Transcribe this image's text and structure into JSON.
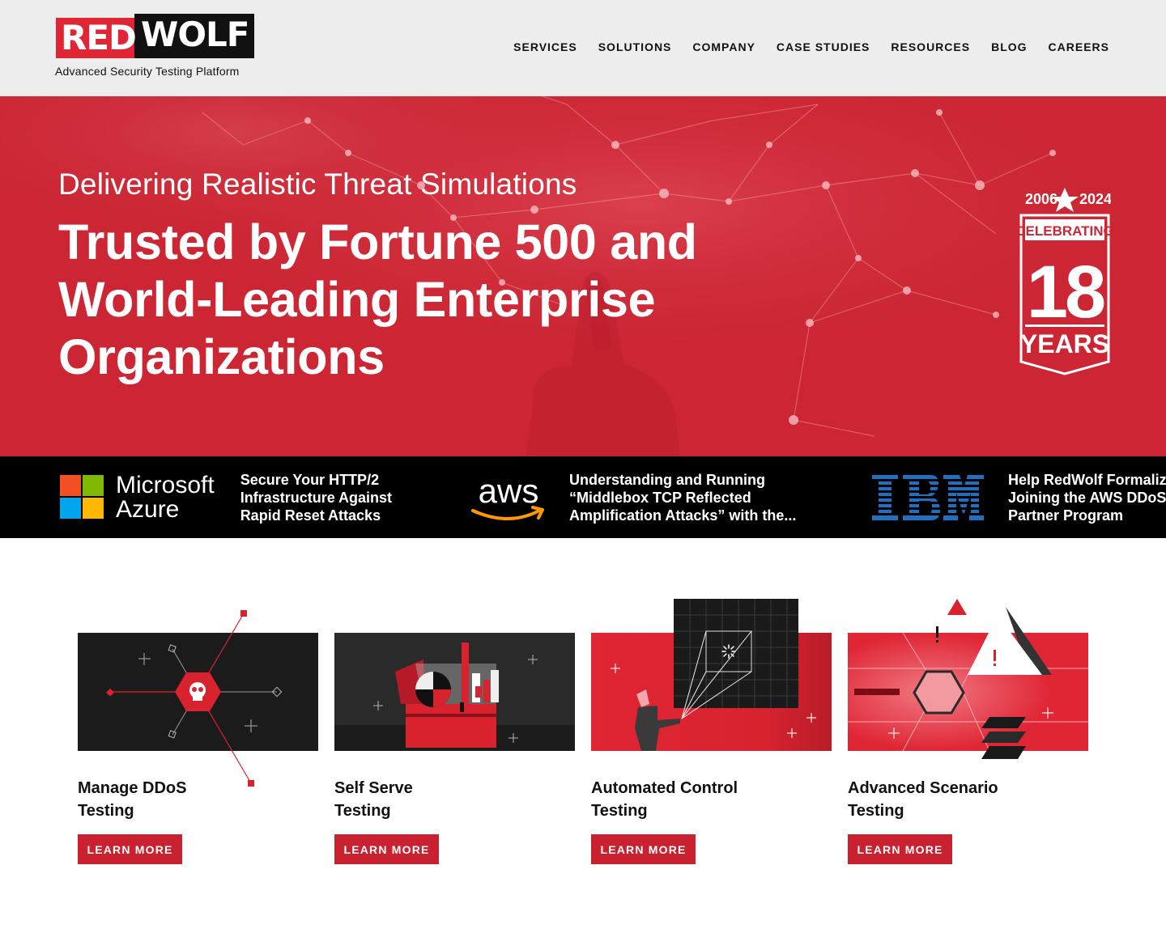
{
  "header": {
    "logo_red": "RED",
    "logo_black": "WOLF",
    "tagline": "Advanced Security Testing Platform",
    "nav": [
      "SERVICES",
      "SOLUTIONS",
      "COMPANY",
      "CASE STUDIES",
      "RESOURCES",
      "BLOG",
      "CAREERS"
    ]
  },
  "hero": {
    "subtitle": "Delivering Realistic Threat Simulations",
    "title": "Trusted by Fortune 500 and World-Leading Enterprise Organizations",
    "badge": {
      "year_start": "2006",
      "year_end": "2024",
      "celebrating": "CELEBRATING",
      "number": "18",
      "years": "YEARS"
    }
  },
  "news": [
    {
      "logo": "Microsoft Azure",
      "logo_line1": "Microsoft",
      "logo_line2": "Azure",
      "line1": "Secure Your HTTP/2",
      "line2": "Infrastructure Against",
      "line3": "Rapid Reset Attacks"
    },
    {
      "logo": "aws",
      "line1": "Understanding and Running",
      "line2": "“Middlebox TCP Reflected",
      "line3": "Amplification Attacks” with the..."
    },
    {
      "logo": "IBM",
      "line1": "Help RedWolf Formaliz",
      "line2": "Joining the AWS DDoS",
      "line3": "Partner Program"
    }
  ],
  "cards": [
    {
      "line1": "Manage DDoS",
      "line2": "Testing",
      "button": "LEARN MORE",
      "icon": "skull-hexagon-icon"
    },
    {
      "line1": "Self Serve",
      "line2": "Testing",
      "button": "LEARN MORE",
      "icon": "toolbox-icon"
    },
    {
      "line1": "Automated Control",
      "line2": "Testing",
      "button": "LEARN MORE",
      "icon": "projector-screen-icon"
    },
    {
      "line1": "Advanced Scenario",
      "line2": "Testing",
      "button": "LEARN MORE",
      "icon": "warning-triangle-icon"
    }
  ],
  "colors": {
    "brand_red": "#e02534",
    "hero_red": "#cc2634",
    "button_red": "#c9212f",
    "header_bg": "#ededed",
    "strip_bg": "#000000"
  }
}
